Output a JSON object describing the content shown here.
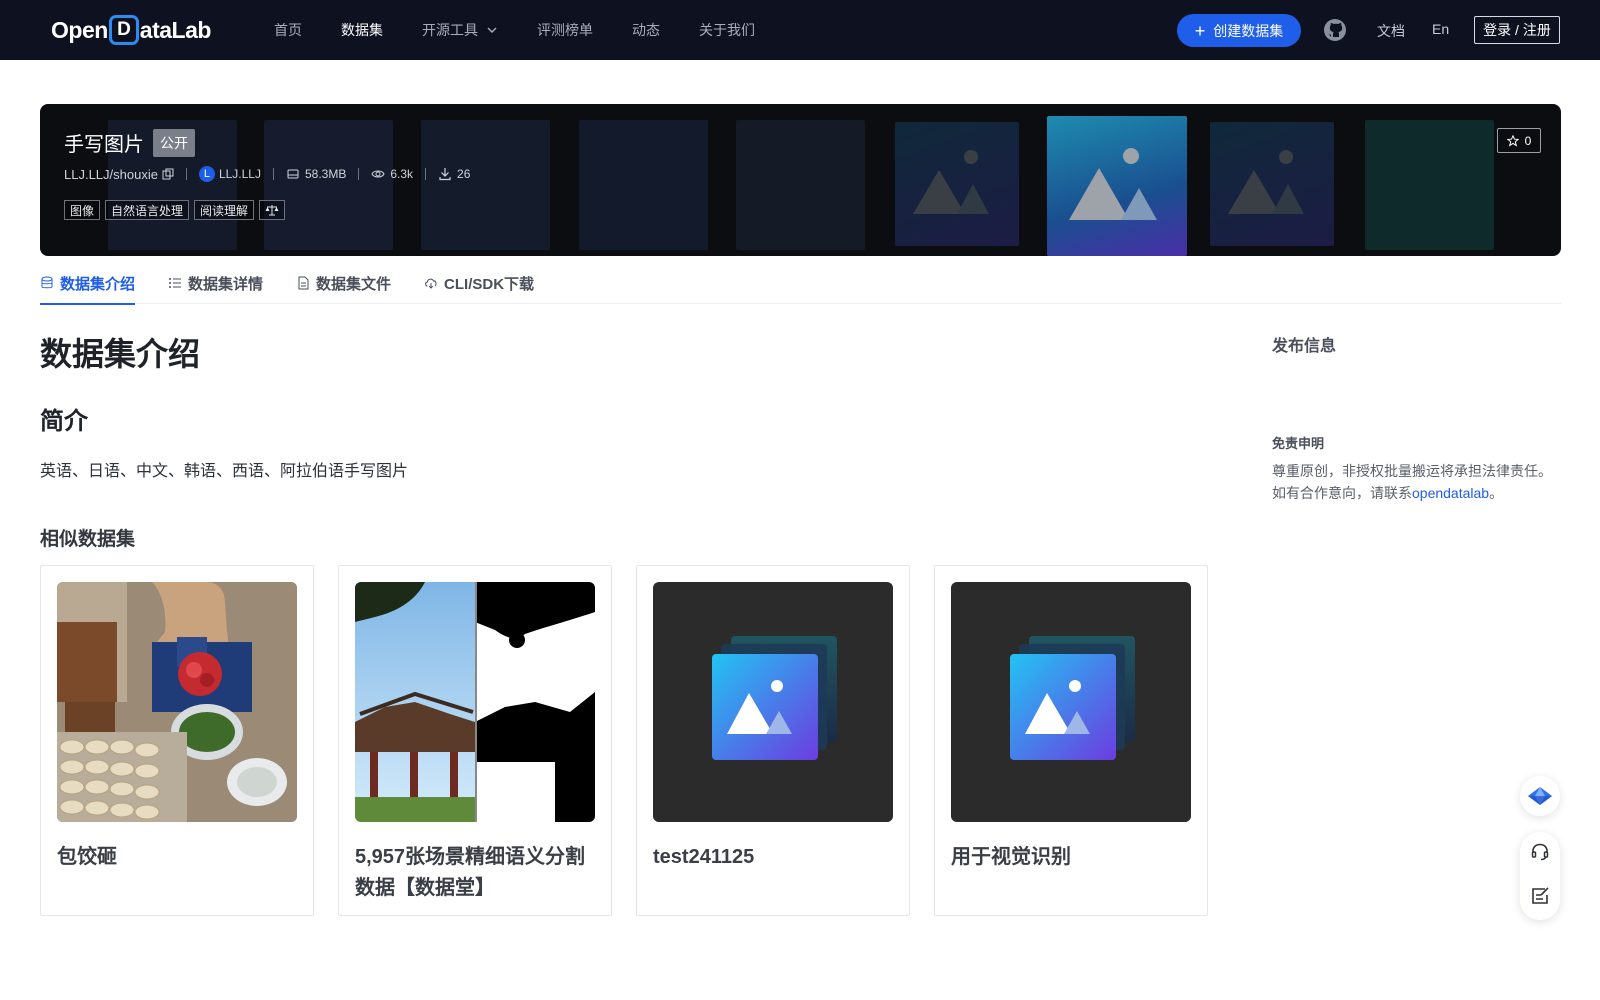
{
  "header": {
    "logo_left": "Open",
    "logo_letter": "D",
    "logo_right": "ataLab",
    "nav": [
      "首页",
      "数据集",
      "开源工具",
      "评测榜单",
      "动态",
      "关于我们"
    ],
    "create_label": "创建数据集",
    "docs_label": "文档",
    "lang_label": "En",
    "login_label": "登录 / 注册",
    "accent_color": "#1f5ee8"
  },
  "banner": {
    "title": "手写图片",
    "visibility": "公开",
    "repo": "LLJ.LLJ/shouxie",
    "avatar_letter": "L",
    "owner": "LLJ.LLJ",
    "size": "58.3MB",
    "views": "6.3k",
    "downloads": "26",
    "tags": [
      "图像",
      "自然语言处理",
      "阅读理解"
    ],
    "star_count": "0"
  },
  "tabs": [
    "数据集介绍",
    "数据集详情",
    "数据集文件",
    "CLI/SDK下载"
  ],
  "main": {
    "heading": "数据集介绍",
    "section_title": "简介",
    "intro_text": "英语、日语、中文、韩语、西语、阿拉伯语手写图片",
    "similar_title": "相似数据集",
    "cards": [
      {
        "title": "包饺砸"
      },
      {
        "title": "5,957张场景精细语义分割数据【数据堂】"
      },
      {
        "title": "test241125"
      },
      {
        "title": "用于视觉识别"
      }
    ]
  },
  "side": {
    "publish_title": "发布信息",
    "disclaimer_title": "免责申明",
    "disclaimer_line1": "尊重原创，非授权批量搬运将承担法律责任。",
    "disclaimer_line2_prefix": "如有合作意向，请联系",
    "disclaimer_link": "opendatalab",
    "disclaimer_suffix": "。"
  }
}
